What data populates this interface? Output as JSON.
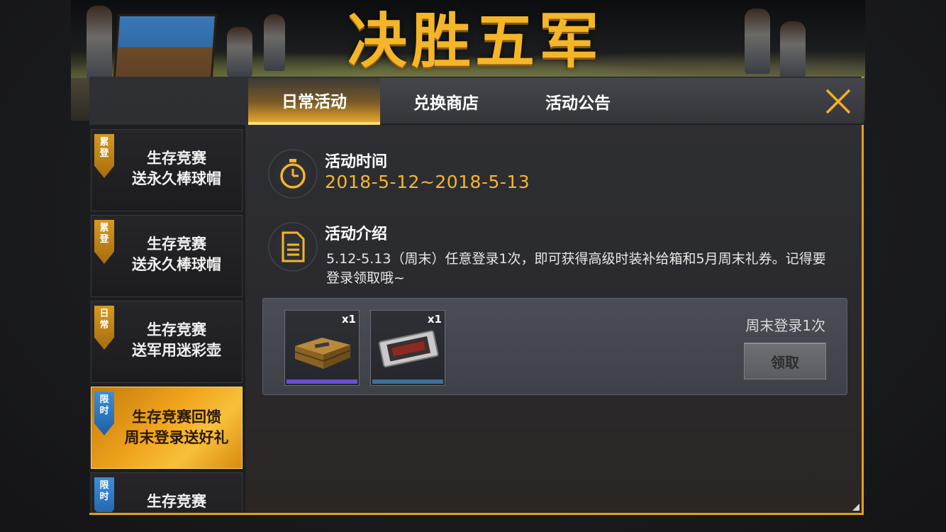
{
  "banner": {
    "title": "决胜五军"
  },
  "tabs": [
    {
      "label": "日常活动",
      "active": true
    },
    {
      "label": "兑换商店",
      "active": false
    },
    {
      "label": "活动公告",
      "active": false
    }
  ],
  "sidebar": {
    "items": [
      {
        "badge_line1": "累",
        "badge_line2": "登",
        "badge_color": "gold",
        "line1": "生存竞赛",
        "line2": "送永久棒球帽",
        "active": false
      },
      {
        "badge_line1": "累",
        "badge_line2": "登",
        "badge_color": "gold",
        "line1": "生存竞赛",
        "line2": "送永久棒球帽",
        "active": false
      },
      {
        "badge_line1": "日",
        "badge_line2": "常",
        "badge_color": "gold",
        "line1": "生存竞赛",
        "line2": "送军用迷彩壶",
        "active": false
      },
      {
        "badge_line1": "限",
        "badge_line2": "时",
        "badge_color": "blue",
        "line1": "生存竞赛回馈",
        "line2": "周末登录送好礼",
        "active": true
      },
      {
        "badge_line1": "限",
        "badge_line2": "时",
        "badge_color": "blue",
        "line1": "生存竞赛",
        "line2": "",
        "active": false
      }
    ]
  },
  "content": {
    "time_title": "活动时间",
    "time_value": "2018-5-12~2018-5-13",
    "intro_title": "活动介绍",
    "intro_text": "5.12-5.13（周末）任意登录1次，即可获得高级时装补给箱和5月周末礼券。记得要登录领取哦~",
    "icons": {
      "time": "stopwatch-icon",
      "intro": "document-icon"
    }
  },
  "reward": {
    "items": [
      {
        "name": "crate-icon",
        "qty": "x1",
        "rarity_color": "#6a4fd0"
      },
      {
        "name": "ticket-icon",
        "qty": "x1",
        "rarity_color": "#3f6f9c"
      }
    ],
    "condition": "周末登录1次",
    "claim_label": "领取"
  },
  "colors": {
    "accent": "#f5b62c",
    "panel_border": "#e0a020"
  }
}
